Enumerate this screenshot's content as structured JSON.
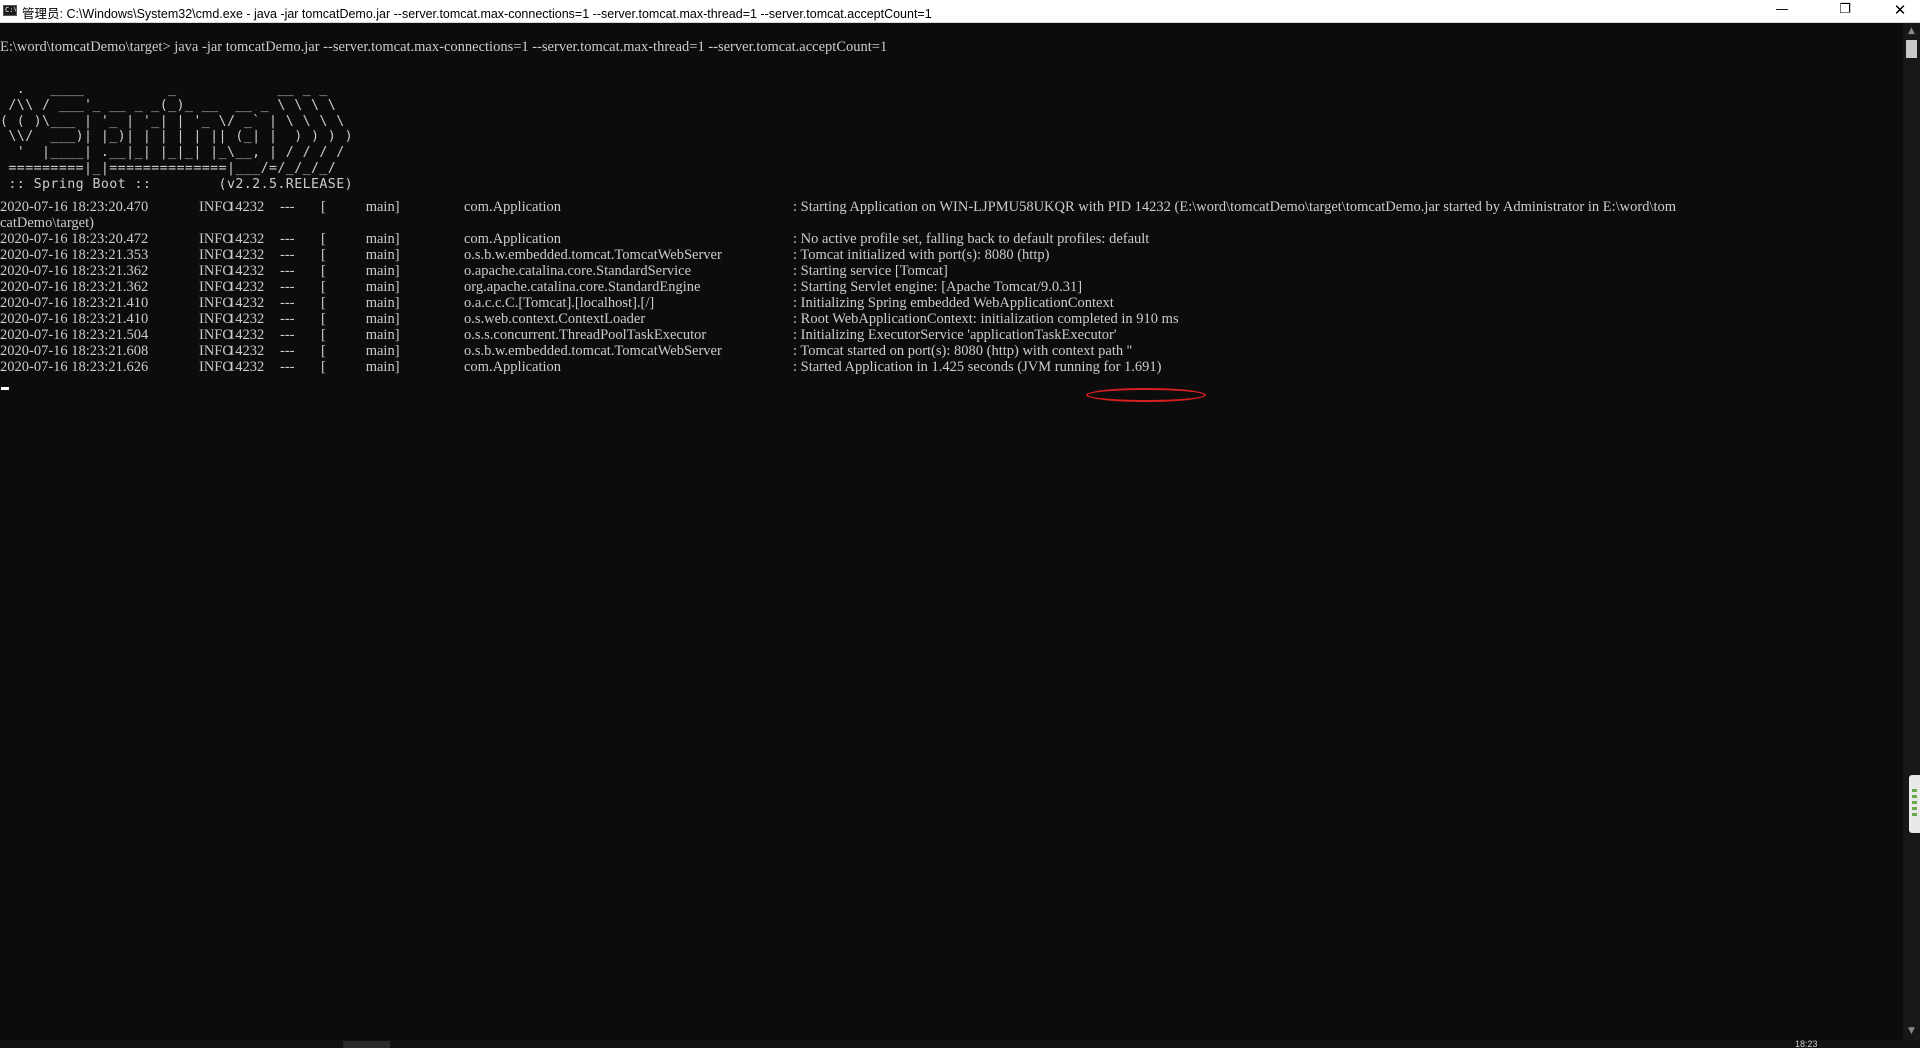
{
  "window": {
    "title": "管理员: C:\\Windows\\System32\\cmd.exe - java  -jar tomcatDemo.jar --server.tomcat.max-connections=1 --server.tomcat.max-thread=1 --server.tomcat.acceptCount=1",
    "icon_text": "C:\\",
    "minimize_glyph": "—",
    "maximize_glyph": "❐",
    "close_glyph": "✕"
  },
  "console": {
    "command_line": "E:\\word\\tomcatDemo\\target> java -jar tomcatDemo.jar --server.tomcat.max-connections=1 --server.tomcat.max-thread=1 --server.tomcat.acceptCount=1",
    "banner": "  .   ____          _            __ _ _\n /\\\\ / ___'_ __ _ _(_)_ __  __ _ \\ \\ \\ \\\n( ( )\\___ | '_ | '_| | '_ \\/ _` | \\ \\ \\ \\\n \\\\/  ___)| |_)| | | | | || (_| |  ) ) ) )\n  '  |____| .__|_| |_|_| |_\\__, | / / / /\n =========|_|==============|___/=/_/_/_/\n :: Spring Boot ::        (v2.2.5.RELEASE)",
    "log_lines": [
      {
        "ts": "2020-07-16 18:23:20.470",
        "level": "INFO",
        "pid": "14232",
        "sep": "---",
        "thread": "[           main]",
        "logger": "com.Application",
        "message": ": Starting Application on WIN-LJPMU58UKQR with PID 14232 (E:\\word\\tomcatDemo\\target\\tomcatDemo.jar started by Administrator in E:\\word\\tom"
      },
      {
        "continuation": "catDemo\\target)"
      },
      {
        "ts": "2020-07-16 18:23:20.472",
        "level": "INFO",
        "pid": "14232",
        "sep": "---",
        "thread": "[           main]",
        "logger": "com.Application",
        "message": ": No active profile set, falling back to default profiles: default"
      },
      {
        "ts": "2020-07-16 18:23:21.353",
        "level": "INFO",
        "pid": "14232",
        "sep": "---",
        "thread": "[           main]",
        "logger": "o.s.b.w.embedded.tomcat.TomcatWebServer",
        "message": ": Tomcat initialized with port(s): 8080 (http)"
      },
      {
        "ts": "2020-07-16 18:23:21.362",
        "level": "INFO",
        "pid": "14232",
        "sep": "---",
        "thread": "[           main]",
        "logger": "o.apache.catalina.core.StandardService",
        "message": ": Starting service [Tomcat]"
      },
      {
        "ts": "2020-07-16 18:23:21.362",
        "level": "INFO",
        "pid": "14232",
        "sep": "---",
        "thread": "[           main]",
        "logger": "org.apache.catalina.core.StandardEngine",
        "message": ": Starting Servlet engine: [Apache Tomcat/9.0.31]"
      },
      {
        "ts": "2020-07-16 18:23:21.410",
        "level": "INFO",
        "pid": "14232",
        "sep": "---",
        "thread": "[           main]",
        "logger": "o.a.c.c.C.[Tomcat].[localhost].[/]",
        "message": ": Initializing Spring embedded WebApplicationContext"
      },
      {
        "ts": "2020-07-16 18:23:21.410",
        "level": "INFO",
        "pid": "14232",
        "sep": "---",
        "thread": "[           main]",
        "logger": "o.s.web.context.ContextLoader",
        "message": ": Root WebApplicationContext: initialization completed in 910 ms"
      },
      {
        "ts": "2020-07-16 18:23:21.504",
        "level": "INFO",
        "pid": "14232",
        "sep": "---",
        "thread": "[           main]",
        "logger": "o.s.s.concurrent.ThreadPoolTaskExecutor",
        "message": ": Initializing ExecutorService 'applicationTaskExecutor'"
      },
      {
        "ts": "2020-07-16 18:23:21.608",
        "level": "INFO",
        "pid": "14232",
        "sep": "---",
        "thread": "[           main]",
        "logger": "o.s.b.w.embedded.tomcat.TomcatWebServer",
        "message": ": Tomcat started on port(s): 8080 (http) with context path ''"
      },
      {
        "ts": "2020-07-16 18:23:21.626",
        "level": "INFO",
        "pid": "14232",
        "sep": "---",
        "thread": "[           main]",
        "logger": "com.Application",
        "message": ": Started Application in 1.425 seconds (JVM running for 1.691)"
      }
    ]
  },
  "scrollbar": {
    "up_glyph": "▲",
    "down_glyph": "▼"
  },
  "taskbar_clock_fragment": "18:23",
  "colors": {
    "console_bg": "#0c0c0c",
    "console_fg": "#cccccc",
    "annotation": "#d62020"
  }
}
